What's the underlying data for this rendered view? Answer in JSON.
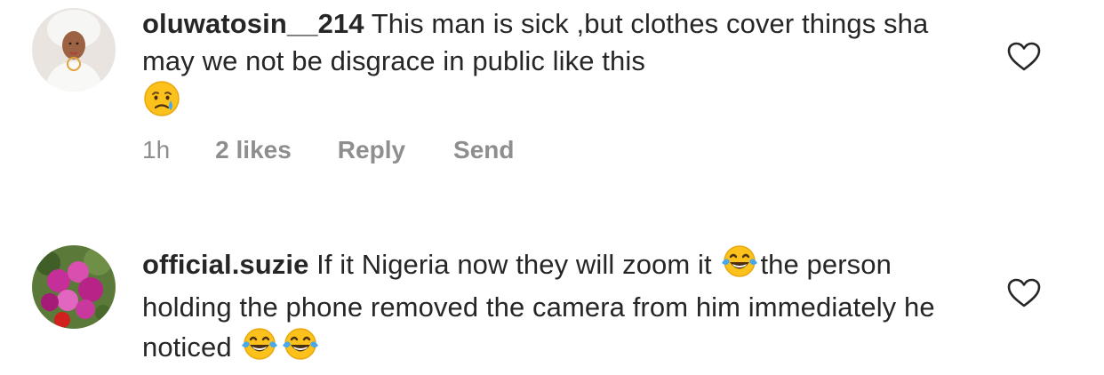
{
  "comments": [
    {
      "username": "oluwatosin__214",
      "text": "This man is sick ,but clothes cover things sha may we not be disgrace in public like this",
      "emoji": "crying-face",
      "time": "1h",
      "likes": "2 likes",
      "reply": "Reply",
      "send": "Send"
    },
    {
      "username": "official.suzie",
      "text_part1": "If it Nigeria now they will zoom it",
      "text_part2": "the person holding the phone removed the camera from him immediately he noticed",
      "emoji": "face-with-tears-of-joy"
    }
  ],
  "colors": {
    "text": "#262626",
    "secondary": "#8e8e8e"
  },
  "icons": [
    "heart-icon",
    "crying-face-emoji",
    "tears-of-joy-emoji"
  ]
}
